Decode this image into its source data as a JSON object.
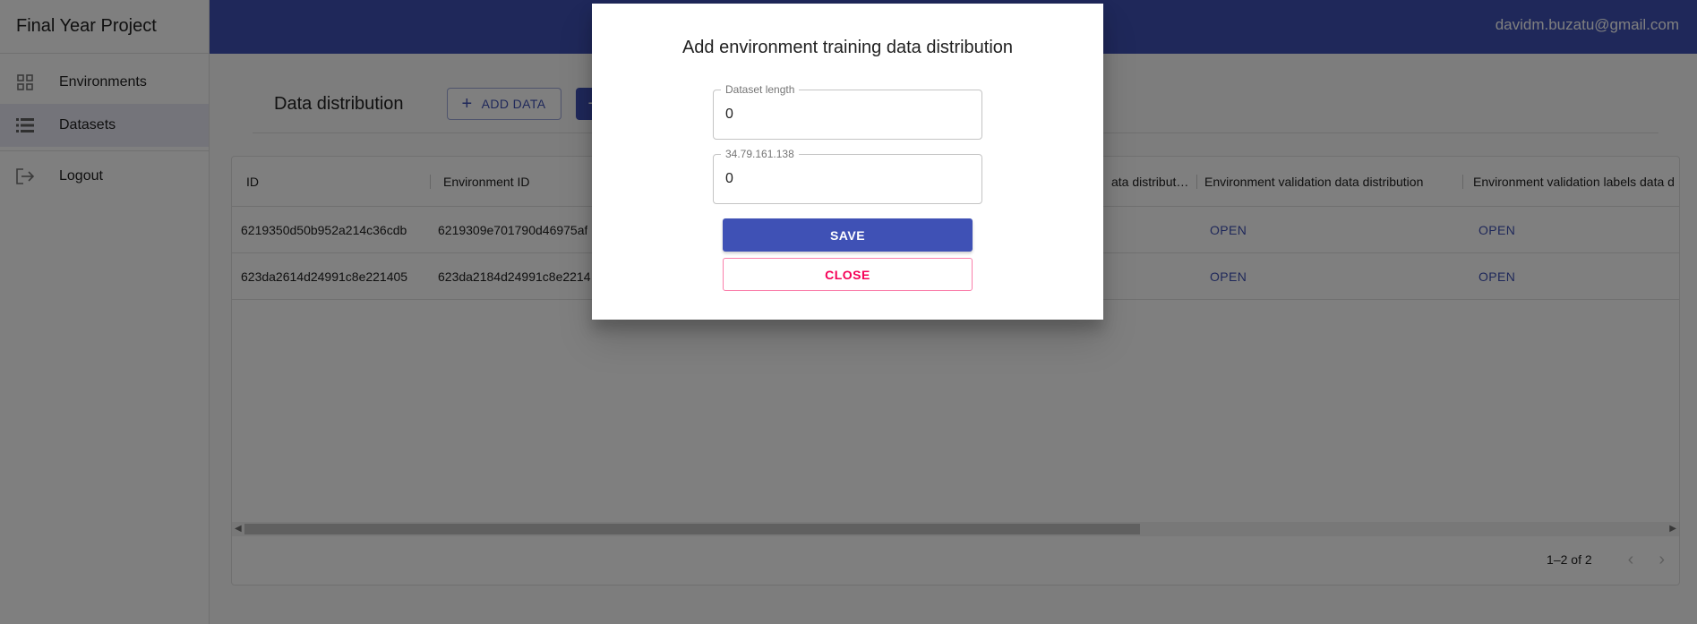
{
  "app": {
    "title": "Final Year Project"
  },
  "topbar": {
    "user_email": "davidm.buzatu@gmail.com"
  },
  "sidebar": {
    "items": [
      {
        "label": "Environments",
        "icon": "dashboard-icon"
      },
      {
        "label": "Datasets",
        "icon": "list-icon"
      },
      {
        "label": "Logout",
        "icon": "logout-icon"
      }
    ]
  },
  "main": {
    "title": "Data distribution",
    "add_data_label": "ADD DATA",
    "second_button_glyph": "+"
  },
  "table": {
    "columns": [
      "ID",
      "Environment ID",
      "ata distribut…",
      "Environment validation data distribution",
      "Environment validation labels data d"
    ],
    "rows": [
      {
        "id": "6219350d50b952a214c36cdb",
        "env_id": "6219309e701790d46975af",
        "val_data": "OPEN",
        "val_labels": "OPEN"
      },
      {
        "id": "623da2614d24991c8e221405",
        "env_id": "623da2184d24991c8e2214",
        "val_data": "OPEN",
        "val_labels": "OPEN"
      }
    ],
    "pagination": "1–2 of 2"
  },
  "modal": {
    "title": "Add environment training data distribution",
    "fields": [
      {
        "label": "Dataset length",
        "value": "0"
      },
      {
        "label": "34.79.161.138",
        "value": "0"
      }
    ],
    "save_label": "SAVE",
    "close_label": "CLOSE"
  },
  "colors": {
    "primary": "#3f51b5",
    "secondary": "#f50057"
  }
}
